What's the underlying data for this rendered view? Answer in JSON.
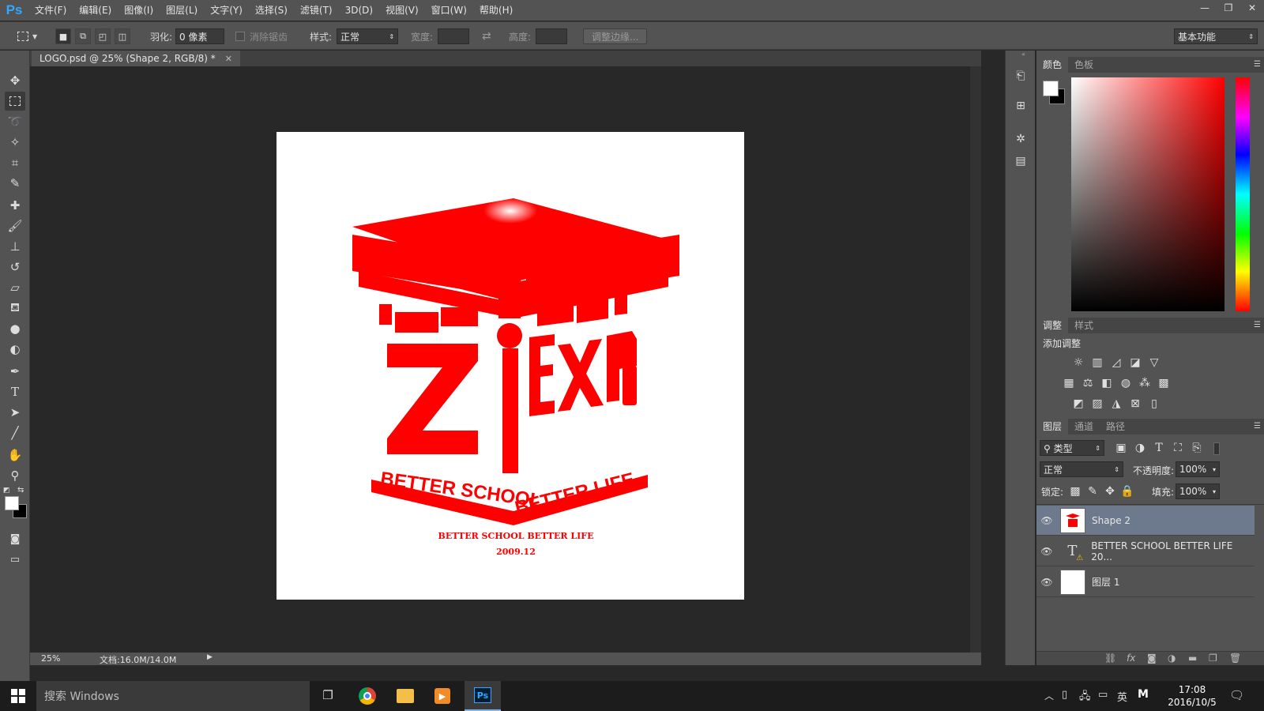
{
  "app": {
    "logo": "Ps",
    "menu": [
      "文件(F)",
      "编辑(E)",
      "图像(I)",
      "图层(L)",
      "文字(Y)",
      "选择(S)",
      "滤镜(T)",
      "3D(D)",
      "视图(V)",
      "窗口(W)",
      "帮助(H)"
    ],
    "window_controls": [
      "—",
      "❐",
      "✕"
    ]
  },
  "options": {
    "feather_label": "羽化:",
    "feather_value": "0 像素",
    "antialias_label": "消除锯齿",
    "style_label": "样式:",
    "style_value": "正常",
    "width_label": "宽度:",
    "height_label": "高度:",
    "refine_edge": "调整边缘...",
    "workspace": "基本功能"
  },
  "document": {
    "tab_title": "LOGO.psd @ 25% (Shape 2, RGB/8) *",
    "zoom": "25%",
    "doc_size": "文档:16.0M/14.0M",
    "logo_lines": [
      "BETTER SCHOOL",
      "BETTER LIFE"
    ],
    "caption_line1": "BETTER SCHOOL BETTER LIFE",
    "caption_line2": "2009.12"
  },
  "color_panel": {
    "tabs": [
      "颜色",
      "色板"
    ]
  },
  "adjust_panel": {
    "tabs": [
      "调整",
      "样式"
    ],
    "add_label": "添加调整"
  },
  "layers_panel": {
    "tabs": [
      "图层",
      "通道",
      "路径"
    ],
    "filter": "类型",
    "blend_mode": "正常",
    "opacity_label": "不透明度:",
    "opacity": "100%",
    "lock_label": "锁定:",
    "fill_label": "填充:",
    "fill": "100%",
    "layers": [
      {
        "name": "Shape 2",
        "selected": true
      },
      {
        "name": "BETTER SCHOOL BETTER LIFE 20...",
        "selected": false
      },
      {
        "name": "图层 1",
        "selected": false
      }
    ]
  },
  "taskbar": {
    "search_placeholder": "搜索 Windows",
    "ime_lang": "英",
    "ime_mode": "M",
    "time": "17:08",
    "date": "2016/10/5"
  },
  "colors": {
    "logo_red": "#ff0000",
    "panel_bg": "#535353",
    "canvas_bg": "#282828",
    "selected_layer": "#6d7a8e"
  }
}
